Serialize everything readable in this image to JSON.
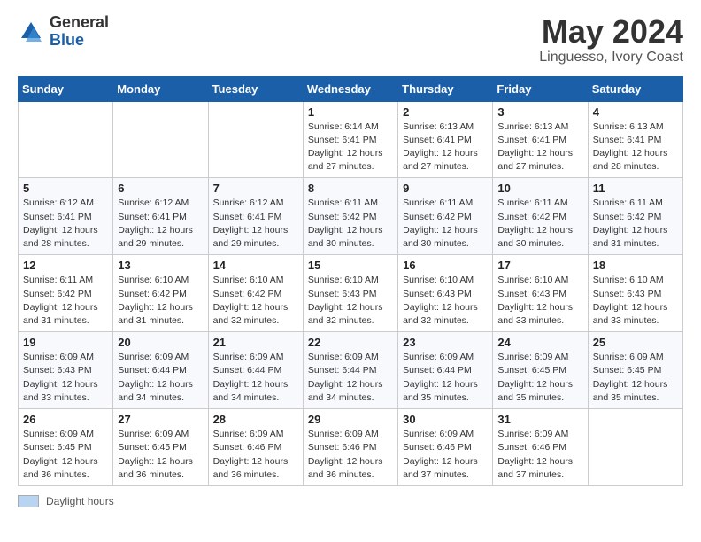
{
  "header": {
    "logo_general": "General",
    "logo_blue": "Blue",
    "month_title": "May 2024",
    "location": "Linguesso, Ivory Coast"
  },
  "days_header": [
    "Sunday",
    "Monday",
    "Tuesday",
    "Wednesday",
    "Thursday",
    "Friday",
    "Saturday"
  ],
  "weeks": [
    [
      {
        "day": "",
        "info": ""
      },
      {
        "day": "",
        "info": ""
      },
      {
        "day": "",
        "info": ""
      },
      {
        "day": "1",
        "info": "Sunrise: 6:14 AM\nSunset: 6:41 PM\nDaylight: 12 hours\nand 27 minutes."
      },
      {
        "day": "2",
        "info": "Sunrise: 6:13 AM\nSunset: 6:41 PM\nDaylight: 12 hours\nand 27 minutes."
      },
      {
        "day": "3",
        "info": "Sunrise: 6:13 AM\nSunset: 6:41 PM\nDaylight: 12 hours\nand 27 minutes."
      },
      {
        "day": "4",
        "info": "Sunrise: 6:13 AM\nSunset: 6:41 PM\nDaylight: 12 hours\nand 28 minutes."
      }
    ],
    [
      {
        "day": "5",
        "info": "Sunrise: 6:12 AM\nSunset: 6:41 PM\nDaylight: 12 hours\nand 28 minutes."
      },
      {
        "day": "6",
        "info": "Sunrise: 6:12 AM\nSunset: 6:41 PM\nDaylight: 12 hours\nand 29 minutes."
      },
      {
        "day": "7",
        "info": "Sunrise: 6:12 AM\nSunset: 6:41 PM\nDaylight: 12 hours\nand 29 minutes."
      },
      {
        "day": "8",
        "info": "Sunrise: 6:11 AM\nSunset: 6:42 PM\nDaylight: 12 hours\nand 30 minutes."
      },
      {
        "day": "9",
        "info": "Sunrise: 6:11 AM\nSunset: 6:42 PM\nDaylight: 12 hours\nand 30 minutes."
      },
      {
        "day": "10",
        "info": "Sunrise: 6:11 AM\nSunset: 6:42 PM\nDaylight: 12 hours\nand 30 minutes."
      },
      {
        "day": "11",
        "info": "Sunrise: 6:11 AM\nSunset: 6:42 PM\nDaylight: 12 hours\nand 31 minutes."
      }
    ],
    [
      {
        "day": "12",
        "info": "Sunrise: 6:11 AM\nSunset: 6:42 PM\nDaylight: 12 hours\nand 31 minutes."
      },
      {
        "day": "13",
        "info": "Sunrise: 6:10 AM\nSunset: 6:42 PM\nDaylight: 12 hours\nand 31 minutes."
      },
      {
        "day": "14",
        "info": "Sunrise: 6:10 AM\nSunset: 6:42 PM\nDaylight: 12 hours\nand 32 minutes."
      },
      {
        "day": "15",
        "info": "Sunrise: 6:10 AM\nSunset: 6:43 PM\nDaylight: 12 hours\nand 32 minutes."
      },
      {
        "day": "16",
        "info": "Sunrise: 6:10 AM\nSunset: 6:43 PM\nDaylight: 12 hours\nand 32 minutes."
      },
      {
        "day": "17",
        "info": "Sunrise: 6:10 AM\nSunset: 6:43 PM\nDaylight: 12 hours\nand 33 minutes."
      },
      {
        "day": "18",
        "info": "Sunrise: 6:10 AM\nSunset: 6:43 PM\nDaylight: 12 hours\nand 33 minutes."
      }
    ],
    [
      {
        "day": "19",
        "info": "Sunrise: 6:09 AM\nSunset: 6:43 PM\nDaylight: 12 hours\nand 33 minutes."
      },
      {
        "day": "20",
        "info": "Sunrise: 6:09 AM\nSunset: 6:44 PM\nDaylight: 12 hours\nand 34 minutes."
      },
      {
        "day": "21",
        "info": "Sunrise: 6:09 AM\nSunset: 6:44 PM\nDaylight: 12 hours\nand 34 minutes."
      },
      {
        "day": "22",
        "info": "Sunrise: 6:09 AM\nSunset: 6:44 PM\nDaylight: 12 hours\nand 34 minutes."
      },
      {
        "day": "23",
        "info": "Sunrise: 6:09 AM\nSunset: 6:44 PM\nDaylight: 12 hours\nand 35 minutes."
      },
      {
        "day": "24",
        "info": "Sunrise: 6:09 AM\nSunset: 6:45 PM\nDaylight: 12 hours\nand 35 minutes."
      },
      {
        "day": "25",
        "info": "Sunrise: 6:09 AM\nSunset: 6:45 PM\nDaylight: 12 hours\nand 35 minutes."
      }
    ],
    [
      {
        "day": "26",
        "info": "Sunrise: 6:09 AM\nSunset: 6:45 PM\nDaylight: 12 hours\nand 36 minutes."
      },
      {
        "day": "27",
        "info": "Sunrise: 6:09 AM\nSunset: 6:45 PM\nDaylight: 12 hours\nand 36 minutes."
      },
      {
        "day": "28",
        "info": "Sunrise: 6:09 AM\nSunset: 6:46 PM\nDaylight: 12 hours\nand 36 minutes."
      },
      {
        "day": "29",
        "info": "Sunrise: 6:09 AM\nSunset: 6:46 PM\nDaylight: 12 hours\nand 36 minutes."
      },
      {
        "day": "30",
        "info": "Sunrise: 6:09 AM\nSunset: 6:46 PM\nDaylight: 12 hours\nand 37 minutes."
      },
      {
        "day": "31",
        "info": "Sunrise: 6:09 AM\nSunset: 6:46 PM\nDaylight: 12 hours\nand 37 minutes."
      },
      {
        "day": "",
        "info": ""
      }
    ]
  ],
  "footer": {
    "swatch_label": "Daylight hours"
  }
}
